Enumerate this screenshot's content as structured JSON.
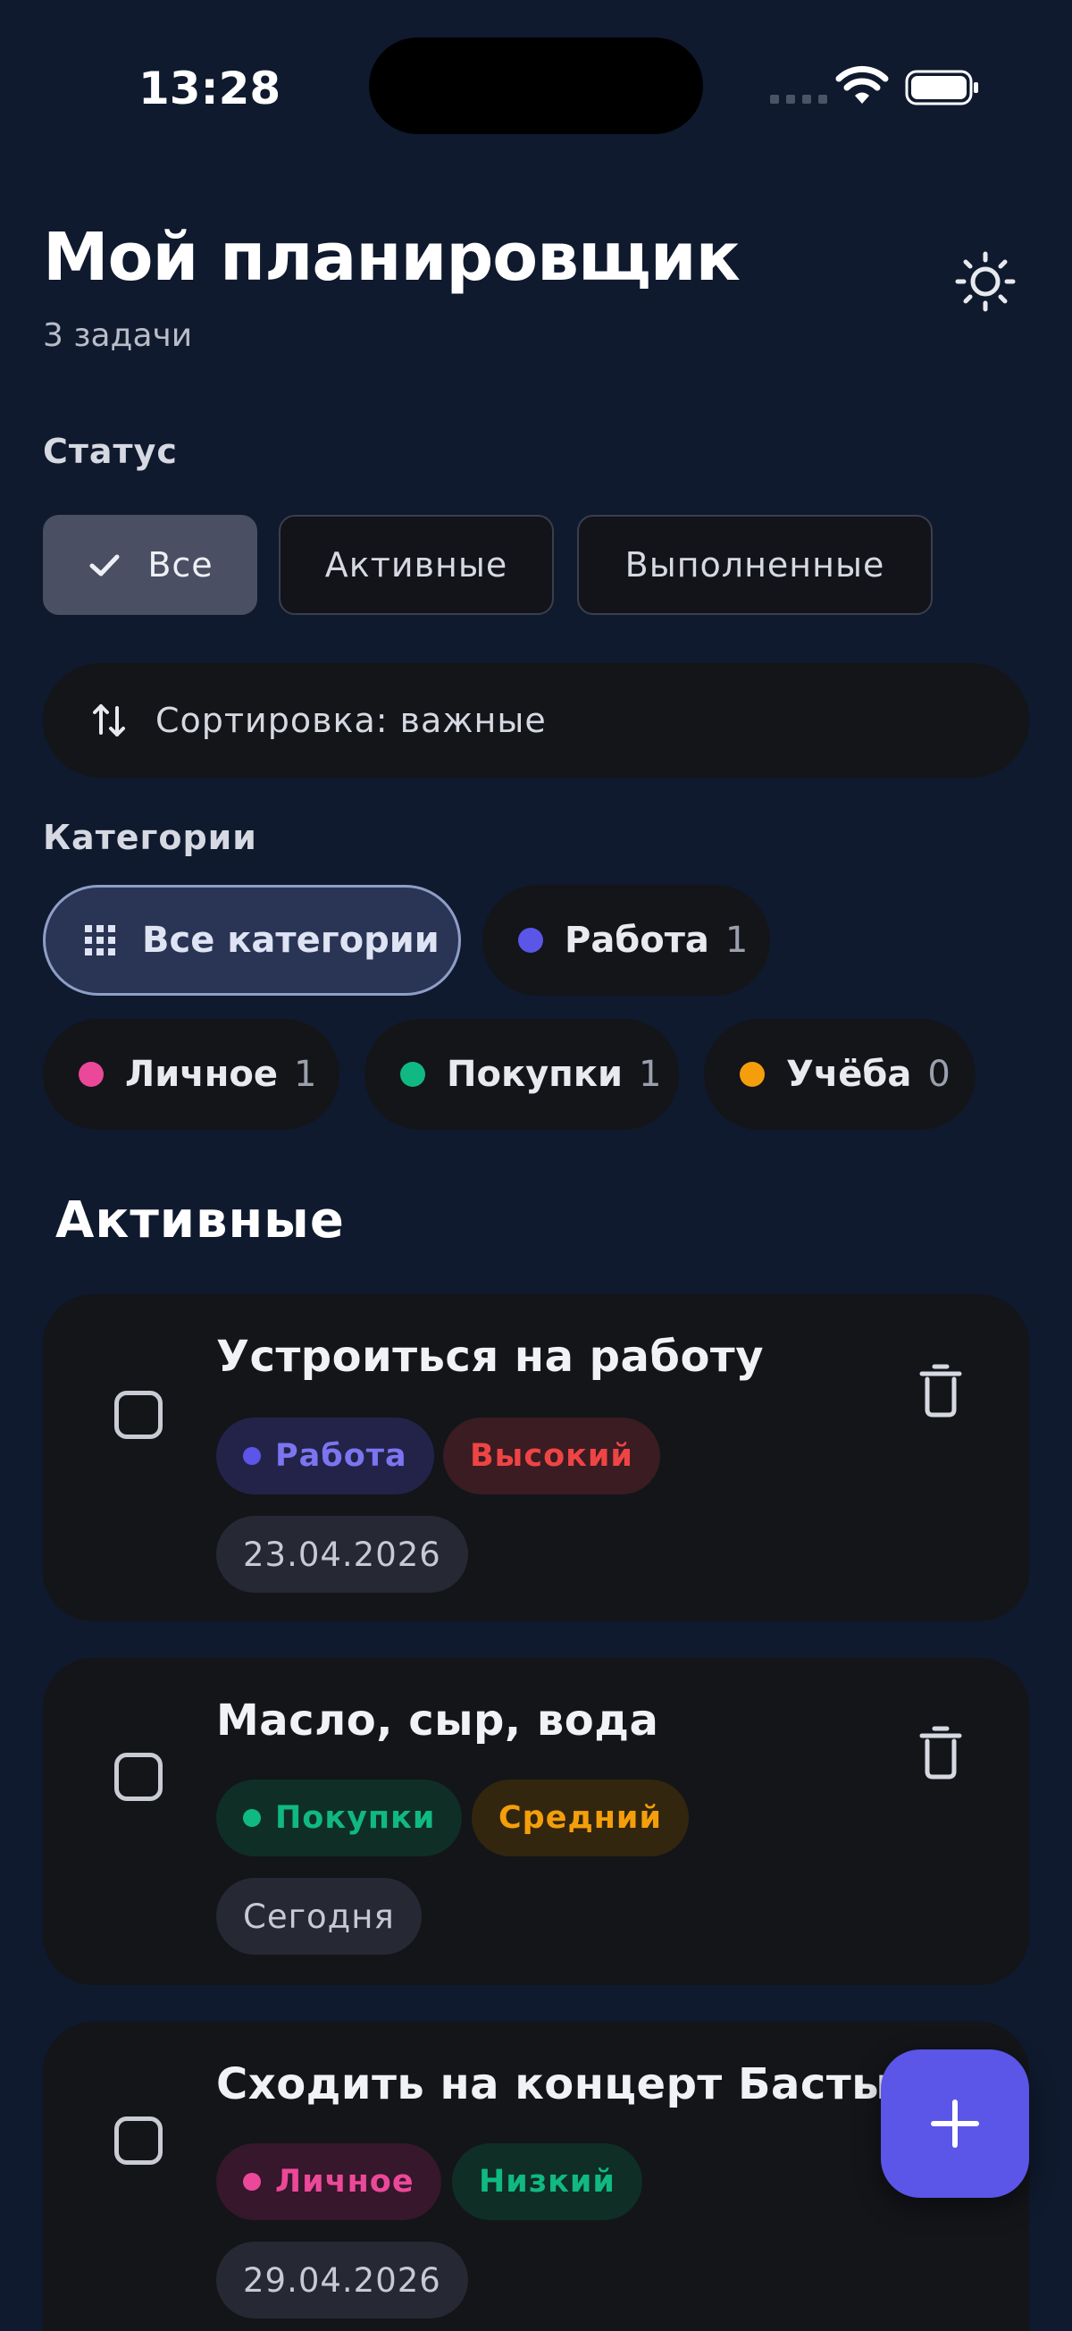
{
  "status_bar": {
    "time": "13:28"
  },
  "header": {
    "title": "Мой планировщик",
    "subtitle": "3 задачи"
  },
  "filters": {
    "status_label": "Статус",
    "status_options": [
      "Все",
      "Активные",
      "Выполненные"
    ],
    "selected_status": "Все",
    "sort_label": "Сортировка: важные",
    "categories_label": "Категории",
    "categories": [
      {
        "label": "Все категории",
        "count": "",
        "icon": "grid-icon",
        "selected": true
      },
      {
        "label": "Работа",
        "count": "1",
        "color": "#5b55e8"
      },
      {
        "label": "Личное",
        "count": "1",
        "color": "#ec4899"
      },
      {
        "label": "Покупки",
        "count": "1",
        "color": "#10b981"
      },
      {
        "label": "Учёба",
        "count": "0",
        "color": "#f59e0b"
      }
    ]
  },
  "section": {
    "active_heading": "Активные"
  },
  "tasks": [
    {
      "title": "Устроиться на работу",
      "category": "Работа",
      "priority": "Высокий",
      "date": "23.04.2026"
    },
    {
      "title": "Масло, сыр, вода",
      "category": "Покупки",
      "priority": "Средний",
      "date": "Сегодня"
    },
    {
      "title": "Сходить на концерт Басты",
      "category": "Личное",
      "priority": "Низкий",
      "date": "29.04.2026"
    }
  ],
  "colors": {
    "background": "#0f1a2e",
    "card": "#131519",
    "accent": "#5b55e8",
    "priority_high": "#ef4444",
    "priority_medium": "#f59e0b",
    "priority_low": "#10b981"
  },
  "icons": {
    "theme_toggle": "sun-icon",
    "sort": "sort-arrows-icon",
    "delete": "trash-icon",
    "add": "plus-icon",
    "check": "checkmark-icon"
  }
}
